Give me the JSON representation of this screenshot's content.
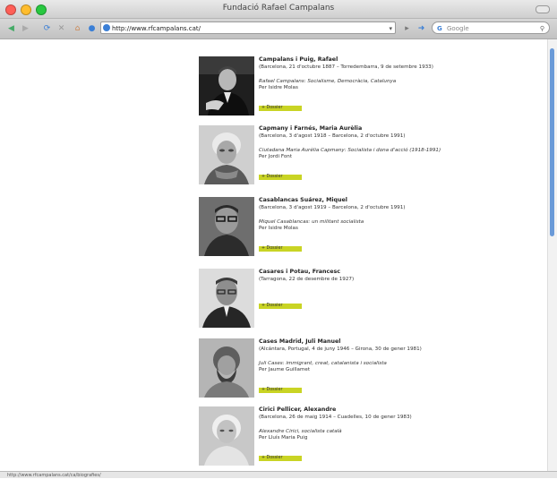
{
  "window": {
    "title": "Fundació Rafael Campalans"
  },
  "toolbar": {
    "url": "http://www.rfcampalans.cat/",
    "search_placeholder": "Google"
  },
  "status": {
    "text": "http://www.rfcampalans.cat/ca/biografies/"
  },
  "entries": [
    {
      "name": "Campalans i Puig, Rafael",
      "dates": "(Barcelona, 21 d'octubre 1887 – Torredembarra, 9 de setembre 1933)",
      "work": "Rafael Campalans: Socialisme, Democràcia, Catalunya",
      "author": "Per Isidre Molas",
      "more": "+ Dossier"
    },
    {
      "name": "Capmany i Farnés, Maria Aurèlia",
      "dates": "(Barcelona, 3 d'agost 1918 – Barcelona, 2 d'octubre 1991)",
      "work": "Ciutadana Maria Aurèlia Capmany: Socialista i dona d'acció (1918-1991)",
      "author": "Per Jordi Font",
      "more": "+ Dossier"
    },
    {
      "name": "Casablancas Suárez, Miquel",
      "dates": "(Barcelona, 3 d'agost 1919 – Barcelona, 2 d'octubre 1991)",
      "work": "Miquel Casablancas: un militant socialista",
      "author": "Per Isidre Molas",
      "more": "+ Dossier"
    },
    {
      "name": "Casares i Potau, Francesc",
      "dates": "(Tarragona, 22 de desembre de 1927)",
      "work": "",
      "author": "",
      "more": "+ Dossier"
    },
    {
      "name": "Cases Madrid, Juli Manuel",
      "dates": "(Alcántara, Portugal, 4 de juny 1946 – Girona, 30 de gener 1981)",
      "work": "Juli Cases: immigrant, creat, catalanista i socialista",
      "author": "Per Jaume Guillamet",
      "more": "+ Dossier"
    },
    {
      "name": "Cirici Pellicer, Alexandre",
      "dates": "(Barcelona, 26 de maig 1914 – Cuadelles, 10 de gener 1983)",
      "work": "Alexandre Cirici, socialista català",
      "author": "Per Lluís Maria Puig",
      "more": "+ Dossier"
    }
  ]
}
